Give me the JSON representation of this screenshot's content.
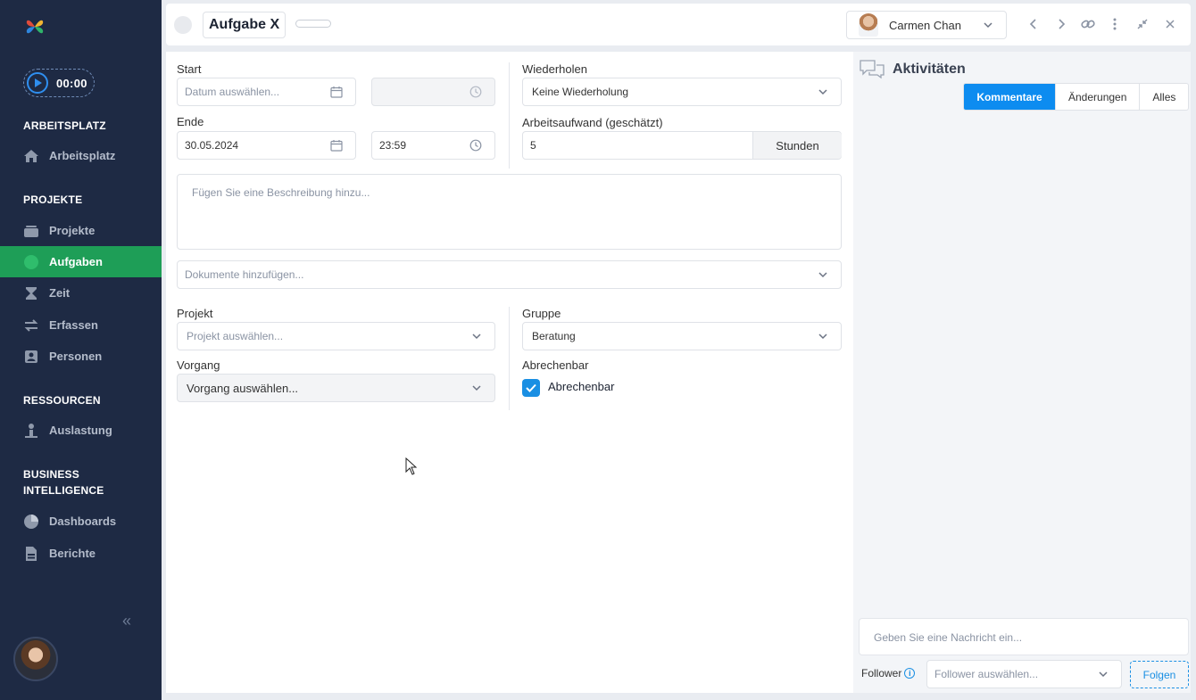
{
  "sidebar": {
    "timer": "00:00",
    "sections": {
      "arbeitsplatz": "ARBEITSPLATZ",
      "projekte": "PROJEKTE",
      "ressourcen": "RESSOURCEN",
      "bi_line1": "BUSINESS",
      "bi_line2": "INTELLIGENCE"
    },
    "items": {
      "arbeitsplatz": "Arbeitsplatz",
      "projekte": "Projekte",
      "aufgaben": "Aufgaben",
      "zeit": "Zeit",
      "erfassen": "Erfassen",
      "personen": "Personen",
      "auslastung": "Auslastung",
      "dashboards": "Dashboards",
      "berichte": "Berichte"
    },
    "collapse_glyph": "«",
    "active_item": "Aufgaben",
    "accent_color": "#1e9e57"
  },
  "header": {
    "task_title": "Aufgabe X",
    "assignee": "Carmen Chan"
  },
  "form": {
    "start_label": "Start",
    "start_date_placeholder": "Datum auswählen...",
    "end_label": "Ende",
    "end_date": "30.05.2024",
    "end_time": "23:59",
    "repeat_label": "Wiederholen",
    "repeat_value": "Keine Wiederholung",
    "effort_label": "Arbeitsaufwand (geschätzt)",
    "effort_value": "5",
    "effort_unit": "Stunden",
    "description_placeholder": "Fügen Sie eine Beschreibung hinzu...",
    "documents_placeholder": "Dokumente hinzufügen...",
    "project_label": "Projekt",
    "project_placeholder": "Projekt auswählen...",
    "group_label": "Gruppe",
    "group_value": "Beratung",
    "process_label": "Vorgang",
    "process_placeholder": "Vorgang auswählen...",
    "billable_label": "Abrechenbar",
    "billable_checkbox_label": "Abrechenbar",
    "billable_checked": true
  },
  "activity": {
    "title": "Aktivitäten",
    "tabs": [
      "Kommentare",
      "Änderungen",
      "Alles"
    ],
    "active_tab": "Kommentare",
    "message_placeholder": "Geben Sie eine Nachricht ein...",
    "follower_label": "Follower",
    "follower_placeholder": "Follower auswählen...",
    "follow_button": "Folgen",
    "accent_color": "#0d8cf0"
  }
}
